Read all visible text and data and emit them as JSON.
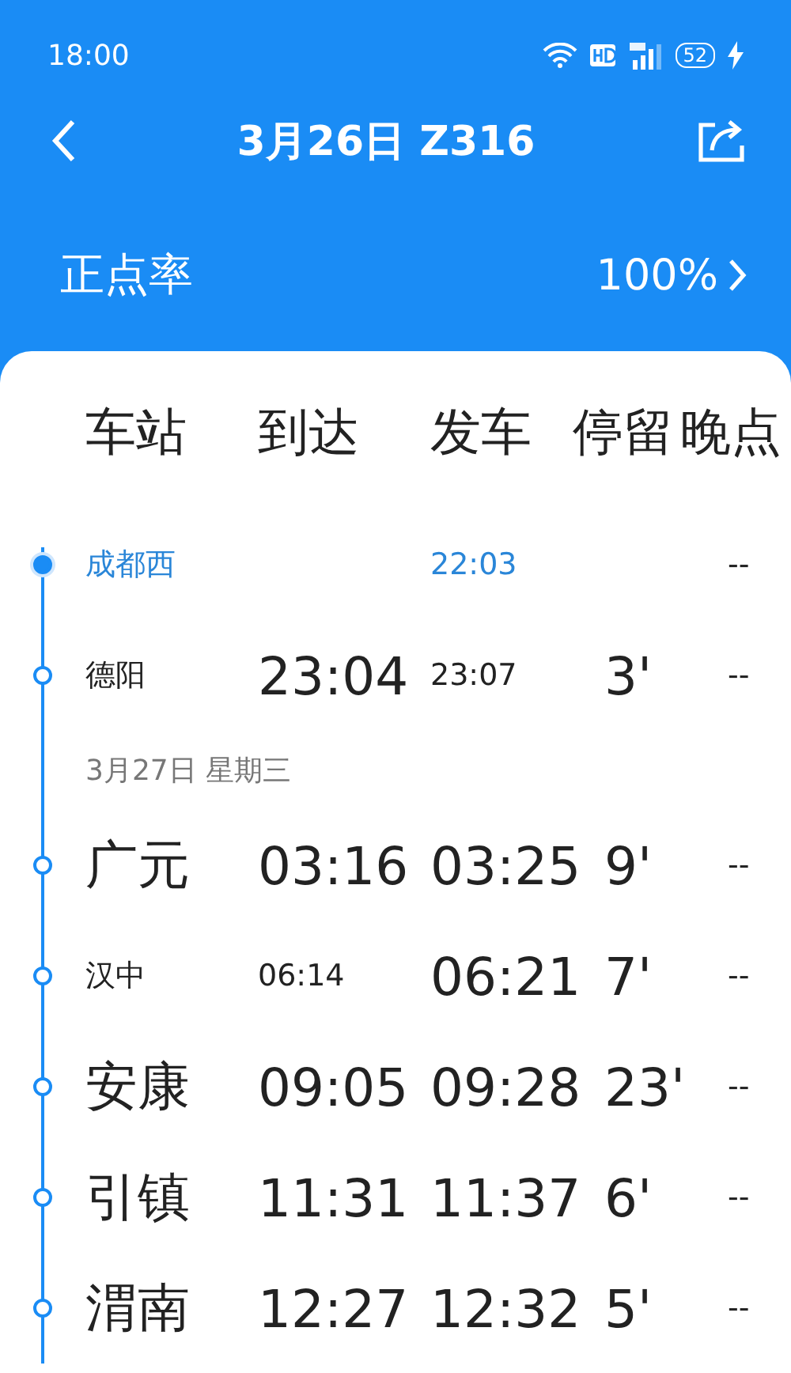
{
  "status_bar": {
    "time": "18:00",
    "battery": "52"
  },
  "nav": {
    "title": "3月26日 Z316"
  },
  "punctuality": {
    "label": "正点率",
    "value": "100%"
  },
  "columns": [
    "车站",
    "到达",
    "发车",
    "停留",
    "晚点"
  ],
  "rows": [
    {
      "kind": "stop",
      "current": true,
      "station": {
        "text": "成都西",
        "big": false
      },
      "depart": {
        "text": "22:03",
        "big": false
      },
      "late": {
        "text": "--",
        "big": false
      }
    },
    {
      "kind": "stop",
      "current": false,
      "station": {
        "text": "德阳",
        "big": false
      },
      "arrive": {
        "text": "23:04",
        "big": true
      },
      "depart": {
        "text": "23:07",
        "big": false
      },
      "stay": {
        "text": "3'",
        "big": true
      },
      "late": {
        "text": "--",
        "big": false
      }
    },
    {
      "kind": "date",
      "text": "3月27日 星期三"
    },
    {
      "kind": "stop",
      "current": false,
      "station": {
        "text": "广元",
        "big": true
      },
      "arrive": {
        "text": "03:16",
        "big": true
      },
      "depart": {
        "text": "03:25",
        "big": true
      },
      "stay": {
        "text": "9'",
        "big": true
      },
      "late": {
        "text": "--",
        "big": false
      }
    },
    {
      "kind": "stop",
      "current": false,
      "station": {
        "text": "汉中",
        "big": false
      },
      "arrive": {
        "text": "06:14",
        "big": false
      },
      "depart": {
        "text": "06:21",
        "big": true
      },
      "stay": {
        "text": "7'",
        "big": true
      },
      "late": {
        "text": "--",
        "big": false
      }
    },
    {
      "kind": "stop",
      "current": false,
      "station": {
        "text": "安康",
        "big": true
      },
      "arrive": {
        "text": "09:05",
        "big": true
      },
      "depart": {
        "text": "09:28",
        "big": true
      },
      "stay": {
        "text": "23'",
        "big": true
      },
      "late": {
        "text": "--",
        "big": false
      }
    },
    {
      "kind": "stop",
      "current": false,
      "station": {
        "text": "引镇",
        "big": true
      },
      "arrive": {
        "text": "11:31",
        "big": true
      },
      "depart": {
        "text": "11:37",
        "big": true
      },
      "stay": {
        "text": "6'",
        "big": true
      },
      "late": {
        "text": "--",
        "big": false
      }
    },
    {
      "kind": "stop",
      "current": false,
      "station": {
        "text": "渭南",
        "big": true
      },
      "arrive": {
        "text": "12:27",
        "big": true
      },
      "depart": {
        "text": "12:32",
        "big": true
      },
      "stay": {
        "text": "5'",
        "big": true
      },
      "late": {
        "text": "--",
        "big": false
      }
    }
  ]
}
